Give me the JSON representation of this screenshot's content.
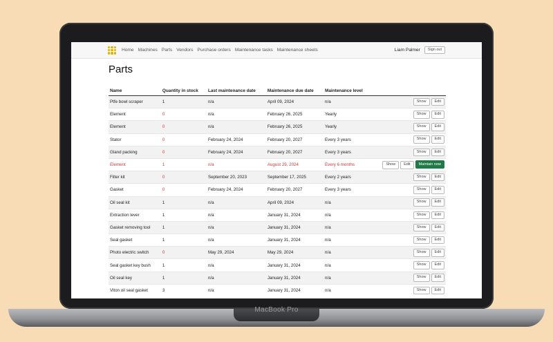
{
  "device": {
    "brand": "MacBook Pro"
  },
  "nav": {
    "links": [
      "Home",
      "Machines",
      "Parts",
      "Vendors",
      "Purchase orders",
      "Maintenance tasks",
      "Maintenance sheets"
    ],
    "user": "Liam Palmer",
    "signout": "Sign out"
  },
  "page": {
    "title": "Parts"
  },
  "table": {
    "headers": [
      "Name",
      "Quantity in stock",
      "Last maintenance date",
      "Maintenance due date",
      "Maintenance level"
    ],
    "show_label": "Show",
    "edit_label": "Edit",
    "maintain_label": "Maintain now",
    "rows": [
      {
        "name": "Ptfe bowl scraper",
        "qty": "1",
        "last": "n/a",
        "due": "April 09, 2024",
        "level": "n/a"
      },
      {
        "name": "Element",
        "qty": "0",
        "last": "n/a",
        "due": "February 26, 2025",
        "level": "Yearly"
      },
      {
        "name": "Element",
        "qty": "0",
        "last": "n/a",
        "due": "February 26, 2025",
        "level": "Yearly"
      },
      {
        "name": "Stator",
        "qty": "0",
        "last": "February 24, 2024",
        "due": "February 20, 2027",
        "level": "Every 3 years"
      },
      {
        "name": "Gland packing",
        "qty": "0",
        "last": "February 24, 2024",
        "due": "February 20, 2027",
        "level": "Every 3 years"
      },
      {
        "name": "Element",
        "qty": "1",
        "last": "n/a",
        "due": "August 29, 2024",
        "level": "Every 6 months"
      },
      {
        "name": "Filter kit",
        "qty": "0",
        "last": "September 20, 2023",
        "due": "September 17, 2025",
        "level": "Every 2 years"
      },
      {
        "name": "Gasket",
        "qty": "0",
        "last": "February 24, 2024",
        "due": "February 20, 2027",
        "level": "Every 3 years"
      },
      {
        "name": "Oil seal kit",
        "qty": "1",
        "last": "n/a",
        "due": "April 09, 2024",
        "level": "n/a"
      },
      {
        "name": "Extraction lever",
        "qty": "1",
        "last": "n/a",
        "due": "January 31, 2024",
        "level": "n/a"
      },
      {
        "name": "Gasket removing tool",
        "qty": "1",
        "last": "n/a",
        "due": "January 31, 2024",
        "level": "n/a"
      },
      {
        "name": "Seal gasket",
        "qty": "1",
        "last": "n/a",
        "due": "January 31, 2024",
        "level": "n/a"
      },
      {
        "name": "Photo electric switch",
        "qty": "0",
        "last": "May 29, 2024",
        "due": "May 29, 2024",
        "level": "n/a"
      },
      {
        "name": "Seal gasket key bush",
        "qty": "1",
        "last": "n/a",
        "due": "January 31, 2024",
        "level": "n/a"
      },
      {
        "name": "Oil seal key",
        "qty": "1",
        "last": "n/a",
        "due": "January 31, 2024",
        "level": "n/a"
      },
      {
        "name": "Viton oil seal gasket",
        "qty": "3",
        "last": "n/a",
        "due": "January 31, 2024",
        "level": "n/a"
      }
    ]
  }
}
